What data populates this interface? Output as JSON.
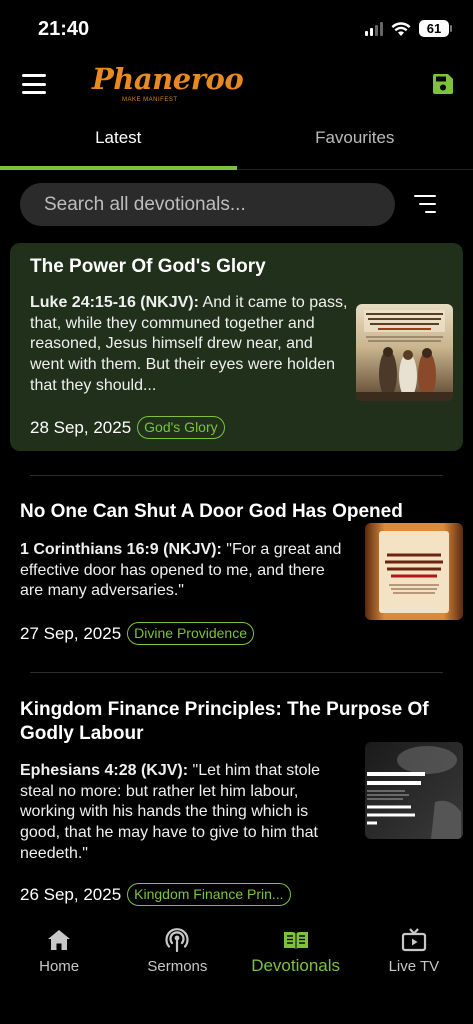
{
  "status_bar": {
    "time": "21:40",
    "battery": "61"
  },
  "header": {
    "logo_main": "Phaneroo",
    "logo_tagline": "MAKE MANIFEST"
  },
  "tabs": [
    {
      "label": "Latest",
      "active": true
    },
    {
      "label": "Favourites",
      "active": false
    }
  ],
  "search": {
    "placeholder": "Search all devotionals..."
  },
  "devotionals": [
    {
      "title": "The Power Of God's Glory",
      "reference": "Luke 24:15-16 (NKJV):",
      "excerpt": " And it came to pass, that, while they communed together and reasoned, Jesus himself drew near, and went with them. But their eyes were holden that they should...",
      "date": "28 Sep,  2025",
      "tag": "God's Glory",
      "highlighted": true,
      "thumb_text": "GOD CAN LIFT YOU TO SUCH A LEVEL THAT EVEN THOSE CLOSE TO YOU WON'T BE ABLE TO EXPLAIN THE CHANGE."
    },
    {
      "title": "No One Can Shut A Door God Has Opened",
      "reference": "1 Corinthians 16:9 (NKJV):",
      "excerpt": " \"For a great and effective door has opened to me, and there are many adversaries.\"",
      "date": "27 Sep,  2025",
      "tag": "Divine Providence",
      "highlighted": false,
      "thumb_text": "WHEN GOD OPENS A DOOR, NO ONE, NOT EVEN THE DEVIL, CAN SHUT IT."
    },
    {
      "title": "Kingdom Finance Principles: The Purpose Of Godly Labour",
      "reference": "Ephesians 4:28 (KJV):",
      "excerpt": " \"Let him that stole steal no more: but rather let him labour, working with his hands the thing which is good, that he may have to give to him that needeth.\"",
      "date": "26 Sep,  2025",
      "tag": "Kingdom Finance Prin...",
      "highlighted": false,
      "thumb_text": "OLY LABOUR OT SELFISH. answer to one else's r."
    }
  ],
  "bottom_nav": [
    {
      "label": "Home",
      "icon": "home-icon",
      "active": false
    },
    {
      "label": "Sermons",
      "icon": "podcast-icon",
      "active": false
    },
    {
      "label": "Devotionals",
      "icon": "book-icon",
      "active": true
    },
    {
      "label": "Live TV",
      "icon": "tv-icon",
      "active": false
    }
  ],
  "colors": {
    "accent": "#7cc23d",
    "logo_orange": "#e98a1e",
    "card_highlight": "#20301a",
    "search_bg": "#2b2b2b"
  }
}
